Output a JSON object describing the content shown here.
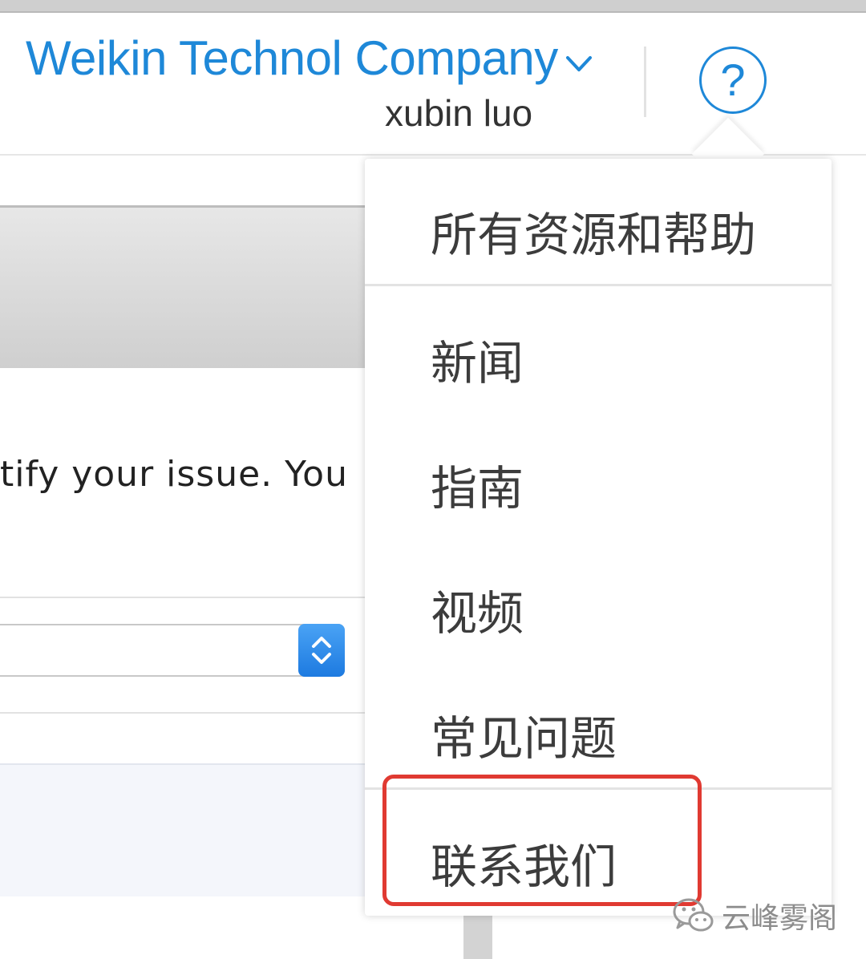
{
  "header": {
    "company_name": "Weikin Technol Company",
    "user_name": "xubin luo",
    "help_label": "?"
  },
  "page": {
    "body_text": "tify your issue. You"
  },
  "help_menu": {
    "items": [
      {
        "label": "所有资源和帮助"
      },
      {
        "label": "新闻"
      },
      {
        "label": "指南"
      },
      {
        "label": "视频"
      },
      {
        "label": "常见问题"
      },
      {
        "label": "联系我们",
        "highlighted": true
      }
    ]
  },
  "watermark": {
    "text": "云峰雾阁"
  },
  "colors": {
    "accent": "#1e88d8",
    "highlight_border": "#e03a32",
    "menu_text": "#3c3c3c"
  }
}
